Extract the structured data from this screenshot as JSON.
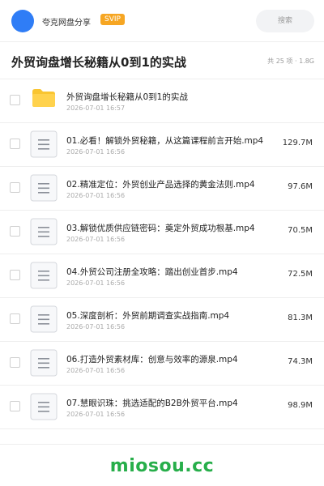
{
  "header": {
    "share_name": "夸克网盘分享",
    "badge": "SVIP",
    "search_placeholder": "搜索"
  },
  "title_row": {
    "title": "外贸询盘增长秘籍从0到1的实战",
    "meta": "共 25 项 · 1.8G"
  },
  "files": [
    {
      "name": "外贸询盘增长秘籍从0到1的实战",
      "date": "2026-07-01 16:57",
      "size": "",
      "type": "folder"
    },
    {
      "name": "01.必看！解锁外贸秘籍，从这篇课程前言开始.mp4",
      "date": "2026-07-01 16:56",
      "size": "129.7M",
      "type": "video"
    },
    {
      "name": "02.精准定位：外贸创业产品选择的黄金法则.mp4",
      "date": "2026-07-01 16:56",
      "size": "97.6M",
      "type": "video"
    },
    {
      "name": "03.解锁优质供应链密码：奠定外贸成功根基.mp4",
      "date": "2026-07-01 16:56",
      "size": "70.5M",
      "type": "video"
    },
    {
      "name": "04.外贸公司注册全攻略：踏出创业首步.mp4",
      "date": "2026-07-01 16:56",
      "size": "72.5M",
      "type": "video"
    },
    {
      "name": "05.深度剖析：外贸前期调查实战指南.mp4",
      "date": "2026-07-01 16:56",
      "size": "81.3M",
      "type": "video"
    },
    {
      "name": "06.打造外贸素材库：创意与效率的源泉.mp4",
      "date": "2026-07-01 16:56",
      "size": "74.3M",
      "type": "video"
    },
    {
      "name": "07.慧眼识珠：挑选适配的B2B外贸平台.mp4",
      "date": "2026-07-01 16:56",
      "size": "98.9M",
      "type": "video"
    }
  ],
  "footer": {
    "brand": "miosou.cc"
  },
  "colors": {
    "accent": "#2f7df6",
    "badge": "#f6a623",
    "folder": "#f9c531",
    "brand": "#27ae4a"
  }
}
